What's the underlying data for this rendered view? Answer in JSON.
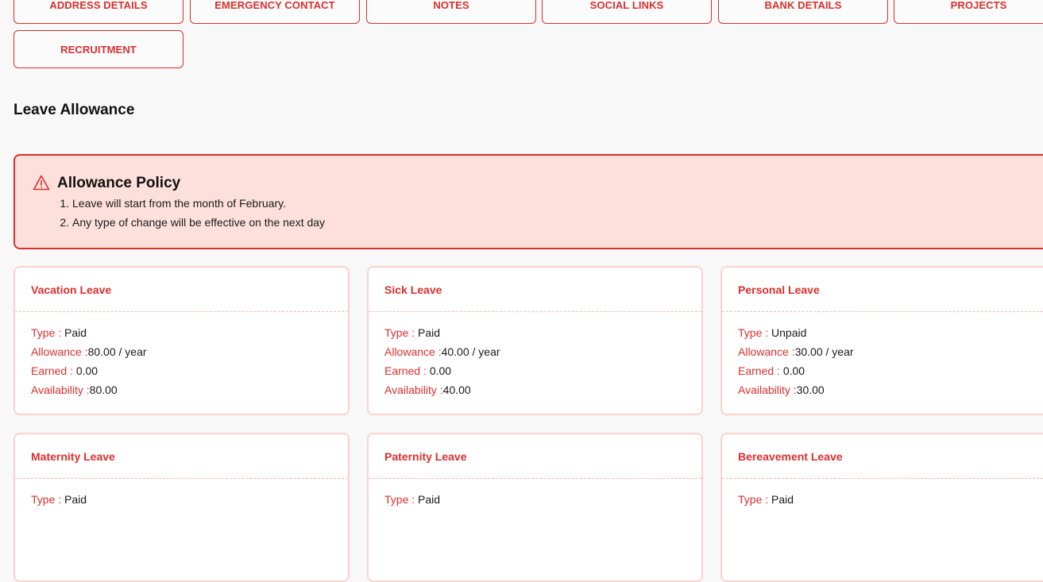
{
  "tabs": [
    "ADDRESS DETAILS",
    "EMERGENCY CONTACT",
    "NOTES",
    "SOCIAL LINKS",
    "BANK DETAILS",
    "PROJECTS",
    "RECRUITMENT"
  ],
  "section_title": "Leave Allowance",
  "policy": {
    "title": "Allowance Policy",
    "items": [
      "Leave will start from the month of February.",
      "Any type of change will be effective on the next day"
    ]
  },
  "labels": {
    "type": "Type : ",
    "allowance": "Allowance :",
    "earned": "Earned : ",
    "availability": "Availability :"
  },
  "leaves": [
    {
      "name": "Vacation Leave",
      "type": "Paid",
      "allowance": "80.00 / year",
      "earned": "0.00",
      "availability": "80.00"
    },
    {
      "name": "Sick Leave",
      "type": "Paid",
      "allowance": "40.00 / year",
      "earned": "0.00",
      "availability": "40.00"
    },
    {
      "name": "Personal Leave",
      "type": "Unpaid",
      "allowance": "30.00 / year",
      "earned": "0.00",
      "availability": "30.00"
    },
    {
      "name": "Maternity Leave",
      "type": "Paid",
      "allowance": "",
      "earned": "",
      "availability": ""
    },
    {
      "name": "Paternity Leave",
      "type": "Paid",
      "allowance": "",
      "earned": "",
      "availability": ""
    },
    {
      "name": "Bereavement Leave",
      "type": "Paid",
      "allowance": "",
      "earned": "",
      "availability": ""
    }
  ],
  "colors": {
    "accent": "#d9302d",
    "policy_bg": "#fde0dc",
    "card_border": "#fbd3cc"
  }
}
